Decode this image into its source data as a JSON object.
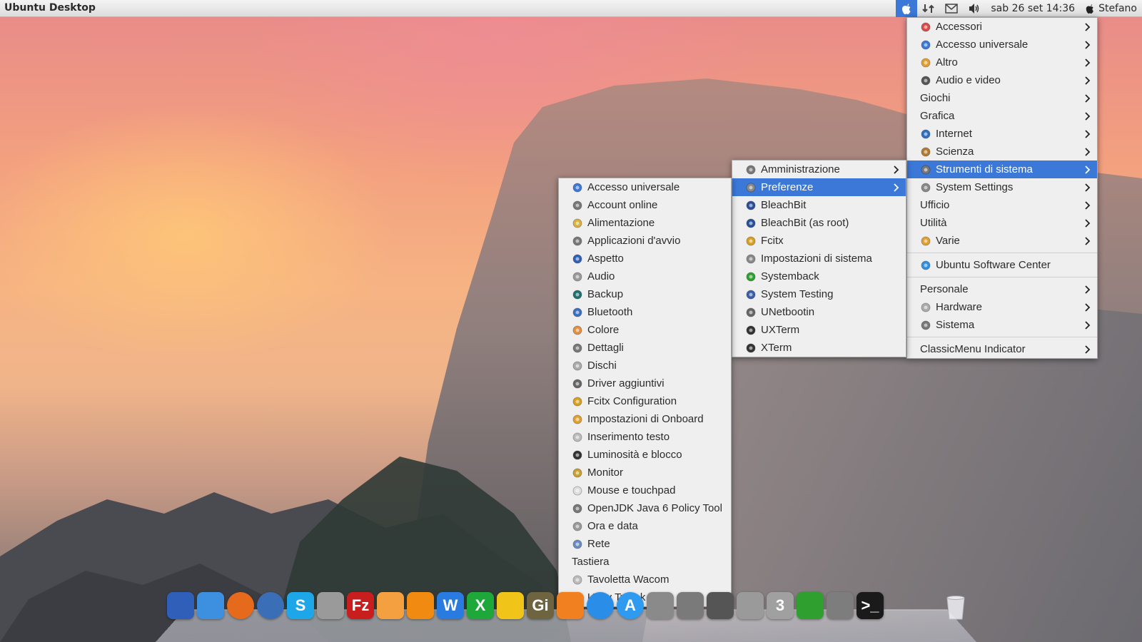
{
  "panel": {
    "title": "Ubuntu Desktop",
    "datetime": "sab 26 set 14:36",
    "user": "Stefano",
    "indicators": [
      "apple-menu-icon",
      "network-icon",
      "mail-icon",
      "volume-icon"
    ]
  },
  "main_menu": {
    "items": [
      {
        "label": "Accessori",
        "icon": "accessories-icon",
        "submenu": true
      },
      {
        "label": "Accesso universale",
        "icon": "accessibility-icon",
        "submenu": true
      },
      {
        "label": "Altro",
        "icon": "other-icon",
        "submenu": true
      },
      {
        "label": "Audio e video",
        "icon": "multimedia-icon",
        "submenu": true
      },
      {
        "label": "Giochi",
        "submenu": true
      },
      {
        "label": "Grafica",
        "submenu": true
      },
      {
        "label": "Internet",
        "icon": "internet-icon",
        "submenu": true
      },
      {
        "label": "Scienza",
        "icon": "science-icon",
        "submenu": true
      },
      {
        "label": "Strumenti di sistema",
        "icon": "system-tools-icon",
        "submenu": true,
        "selected": true
      },
      {
        "label": "System Settings",
        "icon": "system-settings-icon",
        "submenu": true
      },
      {
        "label": "Ufficio",
        "submenu": true
      },
      {
        "label": "Utilità",
        "submenu": true
      },
      {
        "label": "Varie",
        "icon": "misc-icon",
        "submenu": true
      }
    ],
    "software_center": "Ubuntu Software Center",
    "section2": [
      {
        "label": "Personale",
        "submenu": true
      },
      {
        "label": "Hardware",
        "icon": "hardware-icon",
        "submenu": true
      },
      {
        "label": "Sistema",
        "icon": "system-icon",
        "submenu": true
      }
    ],
    "classicmenu": "ClassicMenu Indicator"
  },
  "system_tools_menu": {
    "items": [
      {
        "label": "Amministrazione",
        "icon": "admin-icon",
        "submenu": true
      },
      {
        "label": "Preferenze",
        "icon": "preferences-icon",
        "submenu": true,
        "selected": true
      },
      {
        "label": "BleachBit",
        "icon": "bleachbit-icon"
      },
      {
        "label": "BleachBit (as root)",
        "icon": "bleachbit-root-icon"
      },
      {
        "label": "Fcitx",
        "icon": "fcitx-icon"
      },
      {
        "label": "Impostazioni di sistema",
        "icon": "system-settings-icon"
      },
      {
        "label": "Systemback",
        "icon": "systemback-icon"
      },
      {
        "label": "System Testing",
        "icon": "system-testing-icon"
      },
      {
        "label": "UNetbootin",
        "icon": "unetbootin-icon"
      },
      {
        "label": "UXTerm",
        "icon": "uxterm-icon"
      },
      {
        "label": "XTerm",
        "icon": "xterm-icon"
      }
    ]
  },
  "preferences_menu": {
    "items": [
      {
        "label": "Accesso universale",
        "icon": "accessibility-icon"
      },
      {
        "label": "Account online",
        "icon": "online-accounts-icon"
      },
      {
        "label": "Alimentazione",
        "icon": "power-icon"
      },
      {
        "label": "Applicazioni d'avvio",
        "icon": "startup-apps-icon"
      },
      {
        "label": "Aspetto",
        "icon": "appearance-icon"
      },
      {
        "label": "Audio",
        "icon": "audio-icon"
      },
      {
        "label": "Backup",
        "icon": "backup-icon"
      },
      {
        "label": "Bluetooth",
        "icon": "bluetooth-icon"
      },
      {
        "label": "Colore",
        "icon": "color-icon"
      },
      {
        "label": "Dettagli",
        "icon": "details-icon"
      },
      {
        "label": "Dischi",
        "icon": "disks-icon"
      },
      {
        "label": "Driver aggiuntivi",
        "icon": "drivers-icon"
      },
      {
        "label": "Fcitx Configuration",
        "icon": "fcitx-config-icon"
      },
      {
        "label": "Impostazioni di Onboard",
        "icon": "onboard-icon"
      },
      {
        "label": "Inserimento testo",
        "icon": "text-entry-icon"
      },
      {
        "label": "Luminosità e blocco",
        "icon": "brightness-lock-icon"
      },
      {
        "label": "Monitor",
        "icon": "monitor-icon"
      },
      {
        "label": "Mouse e touchpad",
        "icon": "mouse-icon"
      },
      {
        "label": "OpenJDK Java 6 Policy Tool",
        "icon": "java-icon"
      },
      {
        "label": "Ora e data",
        "icon": "clock-icon"
      },
      {
        "label": "Rete",
        "icon": "network-icon"
      },
      {
        "label": "Tastiera"
      },
      {
        "label": "Tavoletta Wacom",
        "icon": "wacom-icon"
      },
      {
        "label": "Unity Tweak Tool",
        "icon": "unity-tweak-icon"
      }
    ]
  },
  "dock": {
    "icons": [
      {
        "name": "show-desktop-icon",
        "glyph": "",
        "color": "#2f5fb8"
      },
      {
        "name": "finder-icon",
        "glyph": "",
        "color": "#3d8fe0"
      },
      {
        "name": "firefox-icon",
        "glyph": "",
        "color": "#e66a1c"
      },
      {
        "name": "thunderbird-icon",
        "glyph": "",
        "color": "#3a6fb8"
      },
      {
        "name": "skype-icon",
        "glyph": "S",
        "color": "#1ea7e8"
      },
      {
        "name": "gedit-icon",
        "glyph": "",
        "color": "#9a9a9a"
      },
      {
        "name": "filezilla-icon",
        "glyph": "Fz",
        "color": "#c81e1e"
      },
      {
        "name": "cheese-icon",
        "glyph": "",
        "color": "#f4a040"
      },
      {
        "name": "vlc-icon",
        "glyph": "",
        "color": "#f08a10"
      },
      {
        "name": "writer-icon",
        "glyph": "W",
        "color": "#2a7be0"
      },
      {
        "name": "calc-icon",
        "glyph": "X",
        "color": "#1fa83a"
      },
      {
        "name": "radiation-icon",
        "glyph": "",
        "color": "#f0c419"
      },
      {
        "name": "gimp-icon",
        "glyph": "Gi",
        "color": "#6f6440"
      },
      {
        "name": "blender-icon",
        "glyph": "",
        "color": "#f08020"
      },
      {
        "name": "sync-icon",
        "glyph": "",
        "color": "#2a8ee8"
      },
      {
        "name": "app-store-icon",
        "glyph": "A",
        "color": "#2f9bf0"
      },
      {
        "name": "downloads-icon",
        "glyph": "",
        "color": "#8a8a8a"
      },
      {
        "name": "system-preferences-icon",
        "glyph": "",
        "color": "#7a7a7a"
      },
      {
        "name": "x11-icon",
        "glyph": "",
        "color": "#555555"
      },
      {
        "name": "pen-tool-icon",
        "glyph": "",
        "color": "#9a9a9a"
      },
      {
        "name": "script-editor-icon",
        "glyph": "3",
        "color": "#a0a0a0"
      },
      {
        "name": "refresh-green-icon",
        "glyph": "",
        "color": "#2fa02f"
      },
      {
        "name": "disk-utility-icon",
        "glyph": "",
        "color": "#7d7d7d"
      },
      {
        "name": "terminal-icon",
        "glyph": ">_",
        "color": "#1a1a1a"
      }
    ],
    "trash": "trash-icon"
  }
}
